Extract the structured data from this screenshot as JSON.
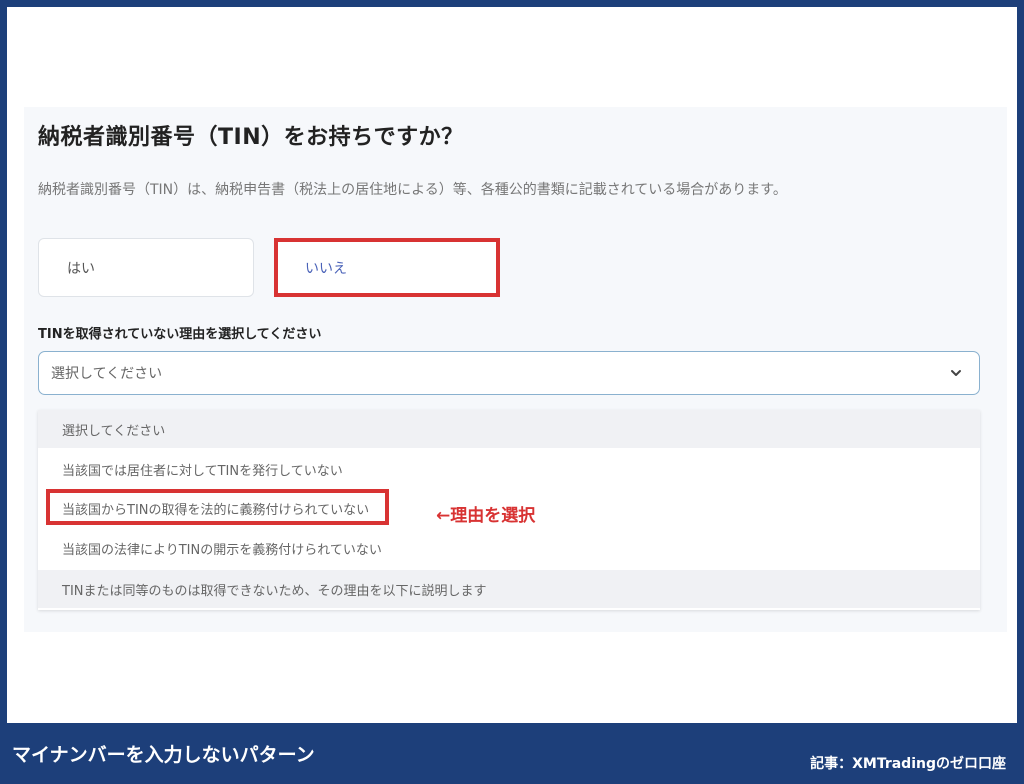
{
  "question": {
    "title": "納税者識別番号（TIN）をお持ちですか？",
    "description": "納税者識別番号（TIN）は、納税申告書（税法上の居住地による）等、各種公的書類に記載されている場合があります。"
  },
  "options": {
    "yes_label": "はい",
    "no_label": "いいえ"
  },
  "reason": {
    "label": "TINを取得されていない理由を選択してください",
    "selected_value": "選択してください",
    "options": [
      "選択してください",
      "当該国では居住者に対してTINを発行していない",
      "当該国からTINの取得を法的に義務付けられていない",
      "当該国の法律によりTINの開示を義務付けられていない",
      "TINまたは同等のものは取得できないため、その理由を以下に説明します"
    ]
  },
  "annotation": {
    "note": "←理由を選択",
    "highlight_color": "#d83333"
  },
  "footer": {
    "caption": "マイナンバーを入力しないパターン",
    "source": "記事：XMTradingのゼロ口座"
  },
  "colors": {
    "frame": "#1d3f7a",
    "accent": "#4a62b8",
    "select_border": "#8ab1cf"
  }
}
